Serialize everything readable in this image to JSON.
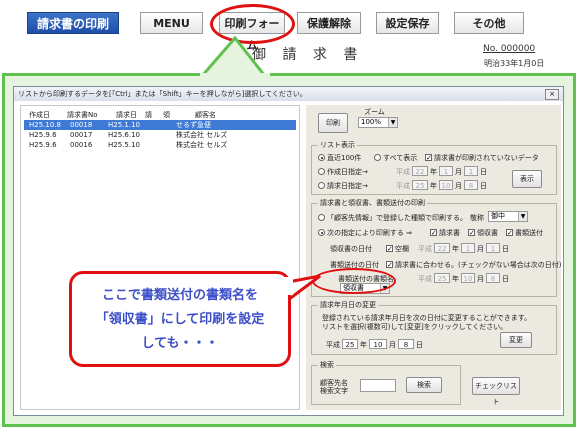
{
  "toolbar": {
    "print_title": "請求書の印刷",
    "menu": "MENU",
    "print_form": "印刷フォーム",
    "unlock": "保護解除",
    "save_settings": "設定保存",
    "other": "その他"
  },
  "document": {
    "title": "御 請 求 書",
    "number": "No. 000000",
    "date": "明治33年1月0日"
  },
  "dialog": {
    "instruction": "リストから印刷するデータを[「Ctrl」または「Shift」キーを押しながら]選択してください。",
    "close": "×",
    "columns": [
      "作成日",
      "請求書No",
      "請求日",
      "請",
      "領",
      "顧客名"
    ],
    "rows": [
      {
        "created": "H25.10.8",
        "no": "00018",
        "billed": "H25.1.10",
        "customer": "せるず急便",
        "selected": true
      },
      {
        "created": "H25.9.6",
        "no": "00017",
        "billed": "H25.6.10",
        "customer": "株式会社 セルズ",
        "selected": false
      },
      {
        "created": "H25.9.6",
        "no": "00016",
        "billed": "H25.5.10",
        "customer": "株式会社 セルズ",
        "selected": false
      }
    ],
    "print_button": "印刷",
    "zoom_label": "ズーム",
    "zoom_value": "100%",
    "list_display": {
      "label": "リスト表示",
      "recent": "直近100件",
      "all": "すべて表示",
      "unprinted": "請求書が印刷されていないデータ",
      "created_after": "作成日指定→",
      "billed_after": "請求日指定→",
      "era": "平成",
      "date1": {
        "y": "22",
        "m": "1",
        "d": "1"
      },
      "date2": {
        "y": "25",
        "m": "10",
        "d": "8"
      },
      "year_unit": "年",
      "month_unit": "月",
      "day_unit": "日",
      "show_button": "表示"
    },
    "print_section": {
      "label": "請求書と領収書、書類送付の印刷",
      "opt1": "「顧客先情報」で登録した種類で印刷する。",
      "honorific_label": "敬称",
      "honorific_value": "御中",
      "opt2": "次の指定により印刷する ⇒",
      "invoice": "請求書",
      "receipt": "領収書",
      "cover": "書類送付",
      "receipt_date_label": "領収書の日付",
      "blank": "空欄",
      "era": "平成",
      "rdate": {
        "y": "22",
        "m": "1",
        "d": "1"
      },
      "cover_date_label": "書類送付の日付",
      "match_invoice": "請求書に合わせる。(チェックがない場合は次の日付)",
      "cdate": {
        "y": "25",
        "m": "10",
        "d": "8"
      },
      "cover_name_label": "書類送付の書類名",
      "cover_name_value": "領収書"
    },
    "billing_date": {
      "label": "請求年月日の変更",
      "desc1": "登録されている請求年月日を次の日付に変更することができます。",
      "desc2": "リストを選択(複数可)して[変更]をクリックしてください。",
      "era": "平成",
      "y": "25",
      "m": "10",
      "d": "8",
      "change_button": "変更"
    },
    "search": {
      "label": "検索",
      "field_label1": "顧客先名",
      "field_label2": "検索文字",
      "search_button": "検索",
      "check_list_button": "チェックリスト"
    }
  },
  "callout": {
    "line1": "ここで書類送付の書類名を",
    "line2": "「領収書」にして印刷を設定",
    "line3": "しても・・・"
  }
}
